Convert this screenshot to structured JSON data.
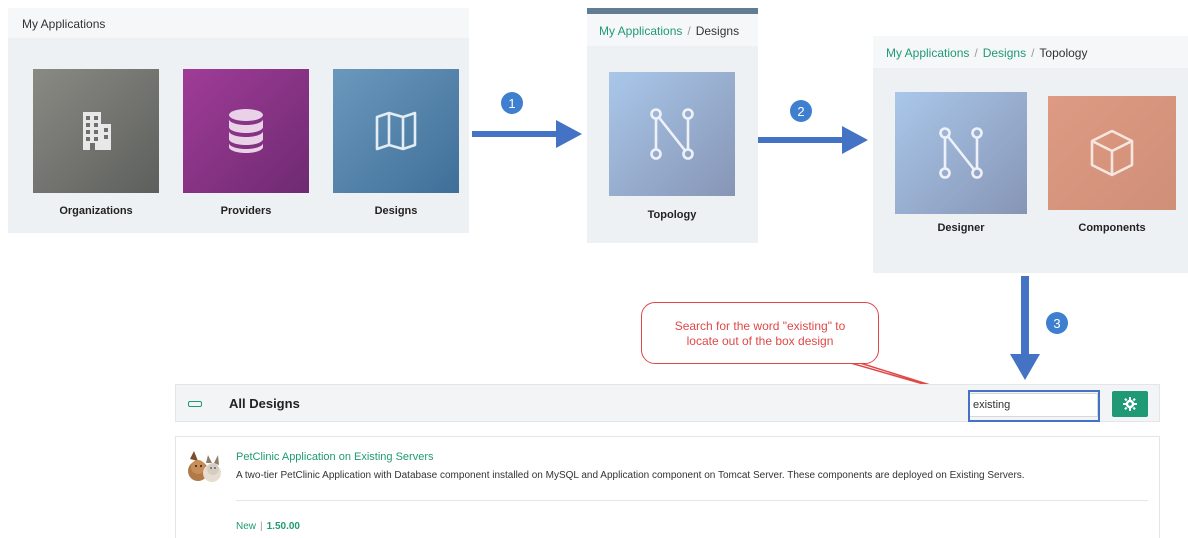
{
  "panel1": {
    "title": "My Applications",
    "tiles": [
      {
        "label": "Organizations",
        "icon": "building-icon",
        "color": "#6f6f6f"
      },
      {
        "label": "Providers",
        "icon": "database-icon",
        "color": "#8e2f8a"
      },
      {
        "label": "Designs",
        "icon": "map-icon",
        "color": "#4d7fa8"
      }
    ]
  },
  "panel2": {
    "breadcrumb": [
      "My Applications",
      "Designs"
    ],
    "tiles": [
      {
        "label": "Topology",
        "icon": "topology-icon"
      }
    ]
  },
  "panel3": {
    "breadcrumb": [
      "My Applications",
      "Designs",
      "Topology"
    ],
    "tiles": [
      {
        "label": "Designer",
        "icon": "topology-icon"
      },
      {
        "label": "Components",
        "icon": "cube-icon",
        "color": "#d9957e"
      }
    ]
  },
  "steps": [
    "1",
    "2",
    "3"
  ],
  "callout": {
    "line1": "Search for the word \"existing\" to",
    "line2": "locate out of the box design"
  },
  "designs": {
    "title": "All Designs",
    "search_value": "existing",
    "item": {
      "title": "PetClinic Application on Existing Servers",
      "description": "A two-tier PetClinic Application with Database component installed on MySQL and Application component on Tomcat Server. These components are deployed on Existing Servers.",
      "status": "New",
      "version": "1.50.00"
    }
  },
  "colors": {
    "accent": "#1f9a74",
    "arrow": "#4472c4",
    "callout": "#e04848"
  }
}
